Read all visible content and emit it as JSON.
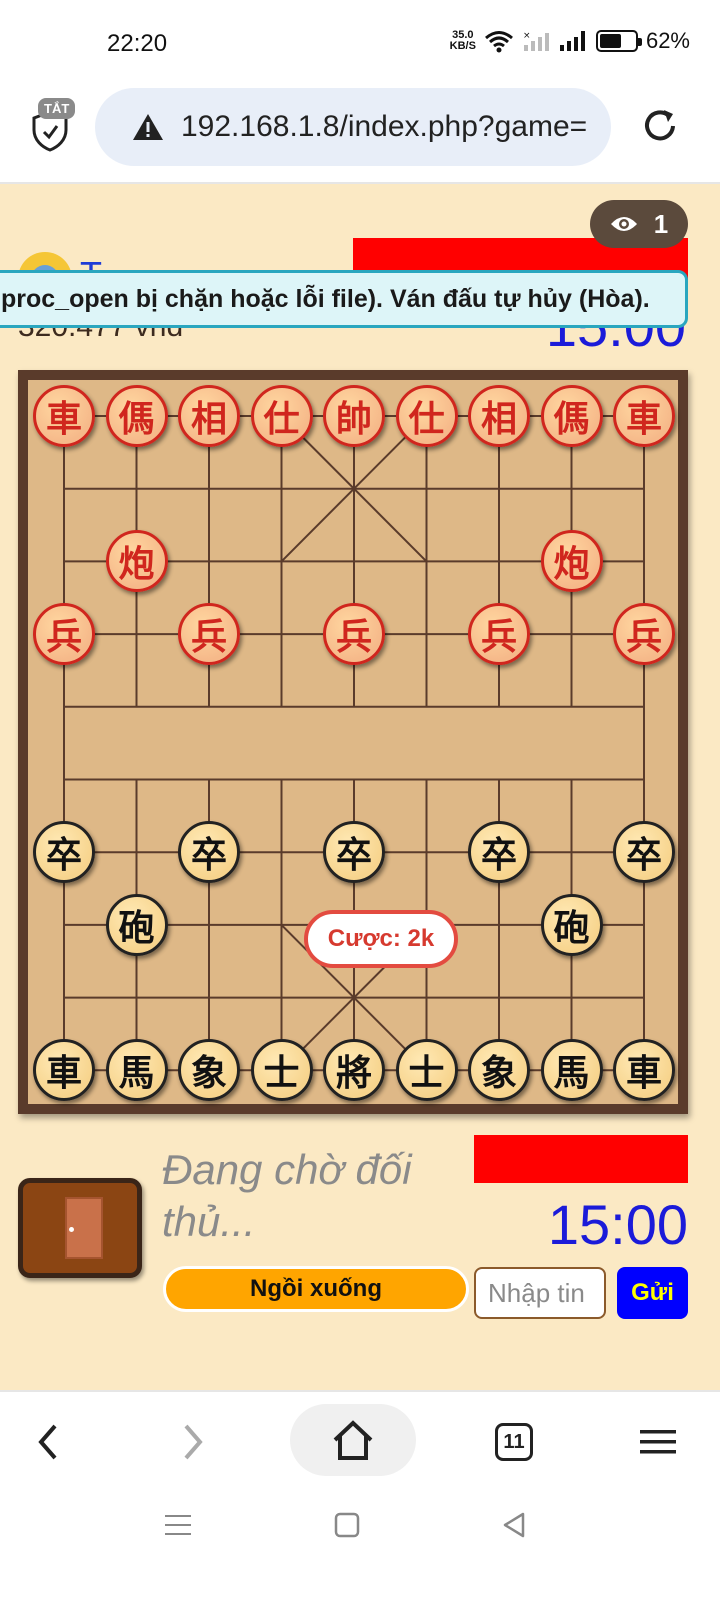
{
  "status_bar": {
    "time": "22:20",
    "net_speed_value": "35.0",
    "net_speed_unit": "KB/S",
    "battery_percent": "62%",
    "battery_level": 0.62
  },
  "browser": {
    "shield_badge": "TẮT",
    "url": "192.168.1.8/index.php?game=",
    "tabs_count": "11"
  },
  "game": {
    "viewer_count": "1",
    "top_player": {
      "name": "T",
      "balance": "320.477 vnđ",
      "timer": "15:00"
    },
    "notification": "proc_open bị chặn hoặc lỗi file). Ván đấu tự hủy (Hòa).",
    "bet_label": "Cược: 2k",
    "bottom_player": {
      "status": "Đang chờ đối thủ...",
      "timer": "15:00"
    },
    "sit_button": "Ngồi xuống",
    "chat_placeholder": "Nhập tin",
    "send_button": "Gửi"
  },
  "board": {
    "pieces": [
      {
        "char": "車",
        "side": "red",
        "file": 0,
        "rank": 0
      },
      {
        "char": "傌",
        "side": "red",
        "file": 1,
        "rank": 0
      },
      {
        "char": "相",
        "side": "red",
        "file": 2,
        "rank": 0
      },
      {
        "char": "仕",
        "side": "red",
        "file": 3,
        "rank": 0
      },
      {
        "char": "帥",
        "side": "red",
        "file": 4,
        "rank": 0
      },
      {
        "char": "仕",
        "side": "red",
        "file": 5,
        "rank": 0
      },
      {
        "char": "相",
        "side": "red",
        "file": 6,
        "rank": 0
      },
      {
        "char": "傌",
        "side": "red",
        "file": 7,
        "rank": 0
      },
      {
        "char": "車",
        "side": "red",
        "file": 8,
        "rank": 0
      },
      {
        "char": "炮",
        "side": "red",
        "file": 1,
        "rank": 2
      },
      {
        "char": "炮",
        "side": "red",
        "file": 7,
        "rank": 2
      },
      {
        "char": "兵",
        "side": "red",
        "file": 0,
        "rank": 3
      },
      {
        "char": "兵",
        "side": "red",
        "file": 2,
        "rank": 3
      },
      {
        "char": "兵",
        "side": "red",
        "file": 4,
        "rank": 3
      },
      {
        "char": "兵",
        "side": "red",
        "file": 6,
        "rank": 3
      },
      {
        "char": "兵",
        "side": "red",
        "file": 8,
        "rank": 3
      },
      {
        "char": "卒",
        "side": "black",
        "file": 0,
        "rank": 6
      },
      {
        "char": "卒",
        "side": "black",
        "file": 2,
        "rank": 6
      },
      {
        "char": "卒",
        "side": "black",
        "file": 4,
        "rank": 6
      },
      {
        "char": "卒",
        "side": "black",
        "file": 6,
        "rank": 6
      },
      {
        "char": "卒",
        "side": "black",
        "file": 8,
        "rank": 6
      },
      {
        "char": "砲",
        "side": "black",
        "file": 1,
        "rank": 7
      },
      {
        "char": "砲",
        "side": "black",
        "file": 7,
        "rank": 7
      },
      {
        "char": "車",
        "side": "black",
        "file": 0,
        "rank": 9
      },
      {
        "char": "馬",
        "side": "black",
        "file": 1,
        "rank": 9
      },
      {
        "char": "象",
        "side": "black",
        "file": 2,
        "rank": 9
      },
      {
        "char": "士",
        "side": "black",
        "file": 3,
        "rank": 9
      },
      {
        "char": "將",
        "side": "black",
        "file": 4,
        "rank": 9
      },
      {
        "char": "士",
        "side": "black",
        "file": 5,
        "rank": 9
      },
      {
        "char": "象",
        "side": "black",
        "file": 6,
        "rank": 9
      },
      {
        "char": "馬",
        "side": "black",
        "file": 7,
        "rank": 9
      },
      {
        "char": "車",
        "side": "black",
        "file": 8,
        "rank": 9
      }
    ]
  },
  "colors": {
    "page_bg": "#fbe9c4",
    "board_bg": "#deb887",
    "board_frame": "#5a3b2b",
    "timer": "#1b1bd9",
    "red_piece": "#d0261e",
    "sit_button": "#ffa500",
    "send_button": "#0000ff"
  }
}
